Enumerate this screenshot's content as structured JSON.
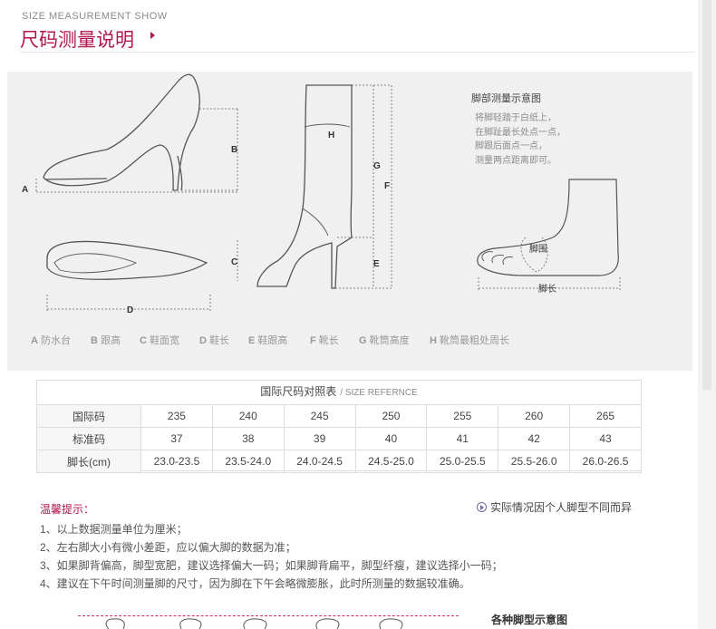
{
  "header": {
    "title_en": "SIZE MEASUREMENT SHOW",
    "title_cn": "尺码测量说明"
  },
  "diagram": {
    "foot_title": "脚部测量示意图",
    "foot_desc": "将脚轻踏于白纸上，\n在脚趾最长处点一点，\n脚跟后面点一点，\n测量两点距离即可。",
    "labels": {
      "A": "A",
      "B": "B",
      "C": "C",
      "D": "D",
      "E": "E",
      "F": "F",
      "G": "G",
      "H": "H",
      "foot_girth": "脚围",
      "foot_length": "脚长"
    },
    "legend": [
      {
        "key": "A",
        "text": "防水台"
      },
      {
        "key": "B",
        "text": "跟高"
      },
      {
        "key": "C",
        "text": "鞋面宽"
      },
      {
        "key": "D",
        "text": "鞋长"
      },
      {
        "key": "E",
        "text": "鞋跟高"
      },
      {
        "key": "F",
        "text": "靴长"
      },
      {
        "key": "G",
        "text": "靴筒高度"
      },
      {
        "key": "H",
        "text": "靴筒最粗处周长"
      }
    ]
  },
  "size_table": {
    "title": "国际尺码对照表",
    "subtitle": "/ SIZE REFERNCE",
    "rows": [
      {
        "header": "国际码",
        "cells": [
          "235",
          "240",
          "245",
          "250",
          "255",
          "260",
          "265"
        ]
      },
      {
        "header": "标准码",
        "cells": [
          "37",
          "38",
          "39",
          "40",
          "41",
          "42",
          "43"
        ]
      },
      {
        "header": "脚长(cm)",
        "cells": [
          "23.0-23.5",
          "23.5-24.0",
          "24.0-24.5",
          "24.5-25.0",
          "25.0-25.5",
          "25.5-26.0",
          "26.0-26.5"
        ]
      }
    ]
  },
  "tips": {
    "title": "温馨提示：",
    "note": "实际情况因个人脚型不同而异",
    "items": [
      "1、以上数据测量单位为厘米；",
      "2、左右脚大小有微小差距，应以偏大脚的数据为准；",
      "3、如果脚背偏高，脚型宽肥，建议选择偏大一码；如果脚背扁平，脚型纤瘦，建议选择小一码；",
      "4、建议在下午时间测量脚的尺寸，因为脚在下午会略微膨胀，此时所测量的数据较准确。"
    ]
  },
  "foot_shapes": {
    "title": "各种脚型示意图"
  },
  "colors": {
    "brand": "#b3154f",
    "panel_bg": "#f0f0f0",
    "table_border": "#dcdcdc"
  }
}
